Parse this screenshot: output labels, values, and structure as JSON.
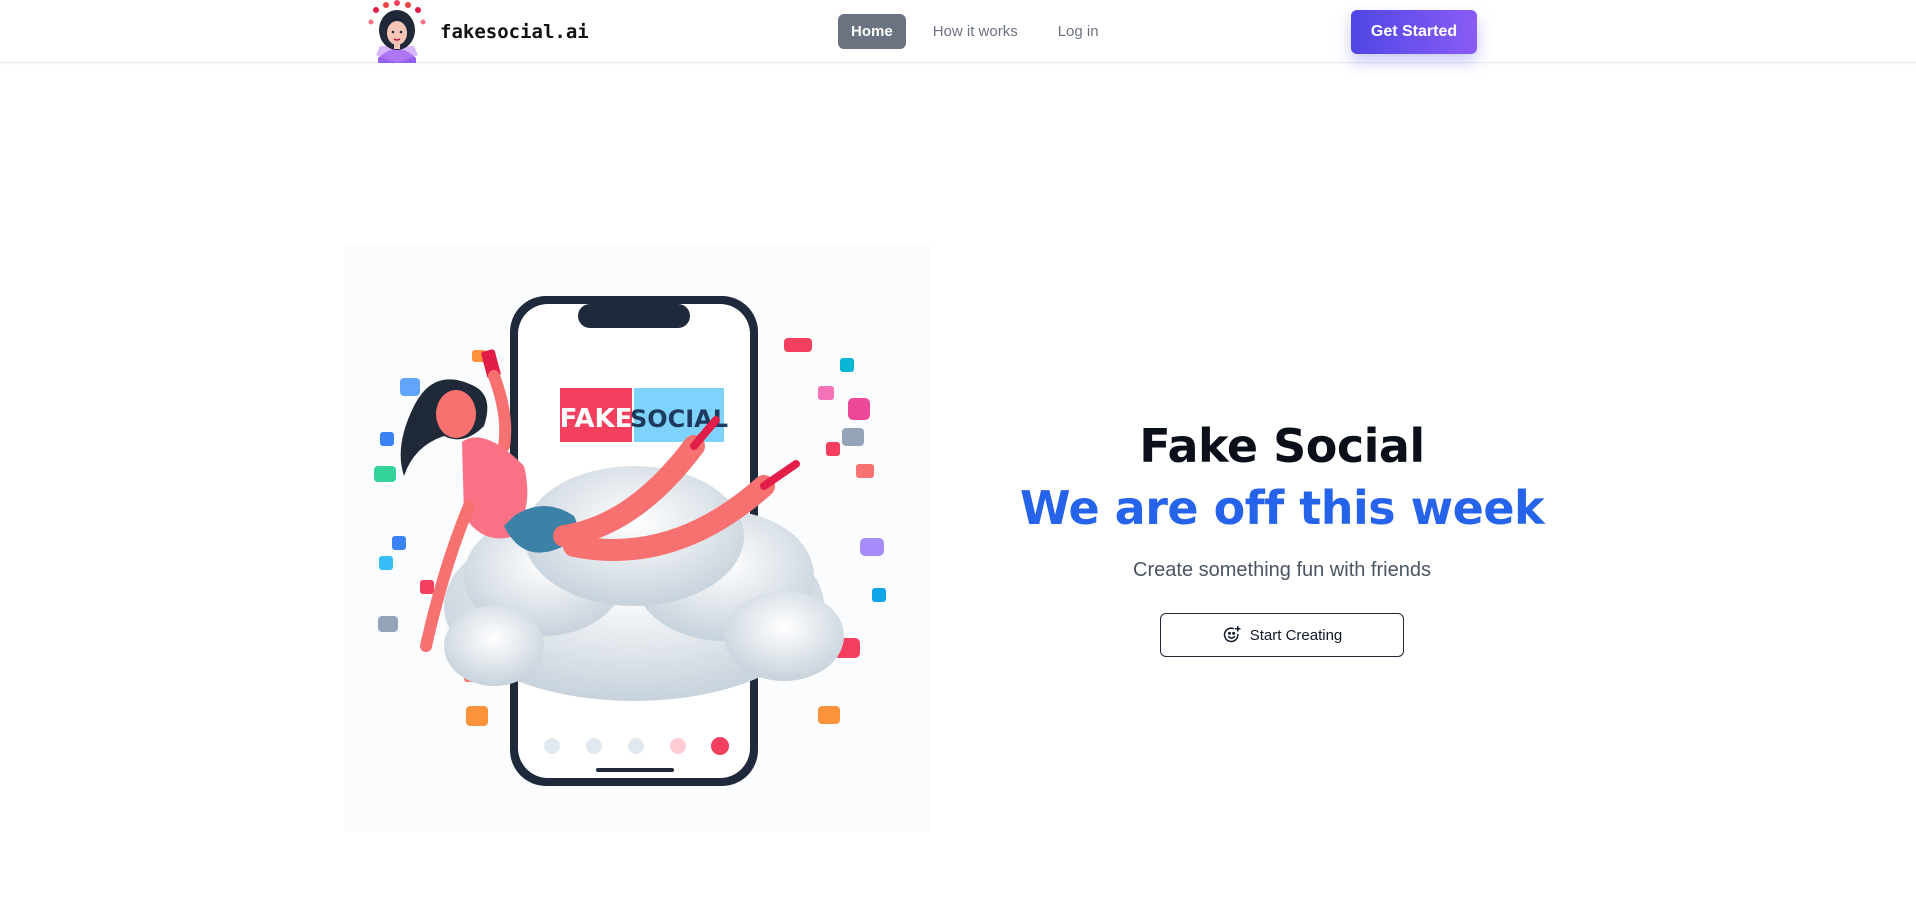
{
  "header": {
    "brand_name": "fakesocial.ai",
    "logo_icon": "woman-portrait-logo",
    "nav": [
      {
        "label": "Home",
        "active": true
      },
      {
        "label": "How it works",
        "active": false
      },
      {
        "label": "Log in",
        "active": false
      }
    ],
    "cta_label": "Get Started",
    "cta_colors": [
      "#4f46e5",
      "#8b5cf6"
    ]
  },
  "hero": {
    "title": "Fake Social",
    "subtitle": "We are off this week",
    "tagline": "Create something fun with friends",
    "button_label": "Start Creating",
    "button_icon": "smiley-sparkle-icon",
    "accent_color": "#2563eb",
    "image": {
      "description_icon": "phone-selfie-illustration",
      "phone_logo_word_1": "FAKE",
      "phone_logo_word_2": "SOCIAL"
    }
  }
}
